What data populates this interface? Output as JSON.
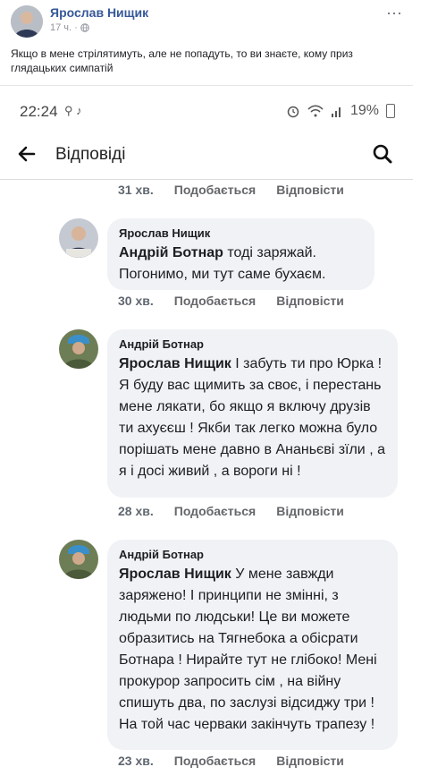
{
  "post": {
    "author": "Ярослав Нищик",
    "time": "17 ч.",
    "more": "···",
    "text": "Якщо в мене стрілятимуть, але не попадуть, то ви знаєте, кому приз глядацьких симпатій"
  },
  "status_bar": {
    "time": "22:24",
    "left_icons": "⚲ ♪",
    "battery": "19%"
  },
  "app_bar": {
    "title": "Відповіді"
  },
  "actions": {
    "like": "Подобається",
    "reply": "Відповісти"
  },
  "top_action_time": "31 хв.",
  "comments": [
    {
      "author": "Ярослав Нищик",
      "mention": "Андрій Ботнар",
      "text": " тоді заряжай. Погонимо, ми тут саме бухаєм.",
      "time": "30 хв."
    },
    {
      "author": "Андрій Ботнар",
      "mention": "Ярослав Нищик",
      "text": " І забуть ти про Юрка ! Я буду вас щимить за своє, і перестань мене лякати, бо якщо я включу друзів ти ахуєєш ! Якби так легко можна було порішать мене давно в Ананьєві зїли , а я і досі живий , а вороги ні !",
      "time": "28 хв."
    },
    {
      "author": "Андрій Ботнар",
      "mention": "Ярослав Нищик",
      "text": " У мене завжди заряжено! І принципи не змінні, з людьми по людськи! Це ви можете образитись на Тягнебока а обісрати Ботнара ! Нирайте тут не глібоко!  Мені прокурор запросить сім , на війну спишуть два, по заслузі відсиджу три ! На той час черваки закінчуть трапезу !",
      "time": "23 хв."
    }
  ]
}
